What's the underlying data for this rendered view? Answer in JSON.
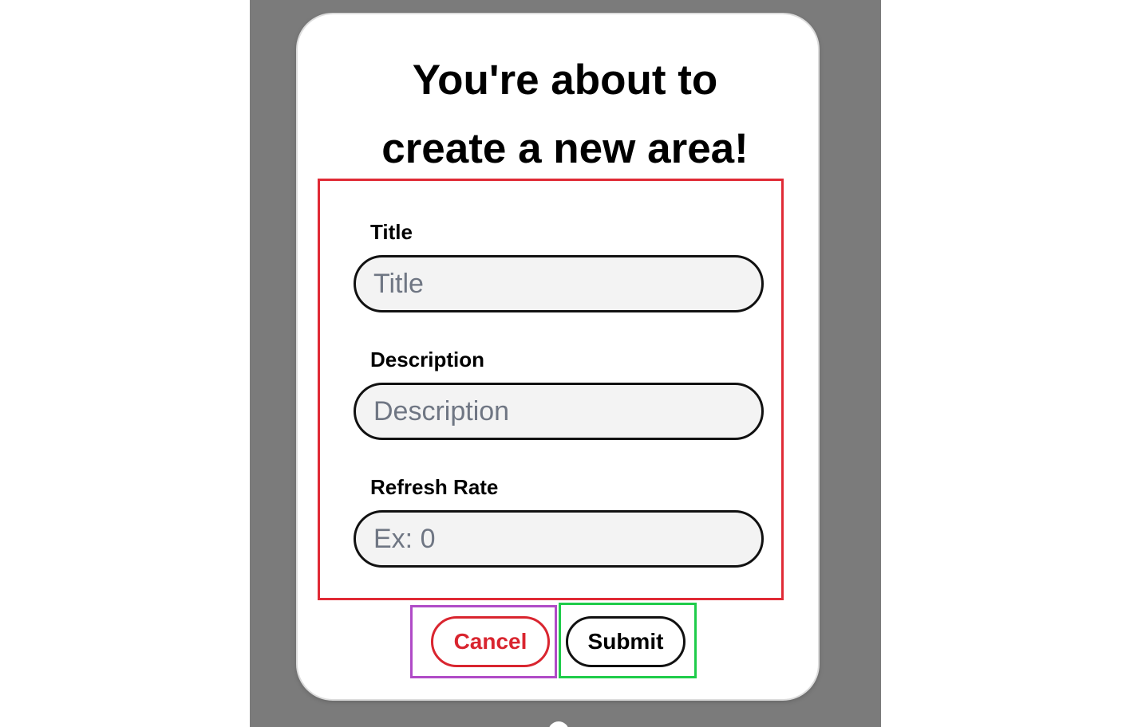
{
  "dialog": {
    "title_line1": "You're about to",
    "title_line2": "create a new area!"
  },
  "form": {
    "fields": [
      {
        "label": "Title",
        "placeholder": "Title",
        "value": ""
      },
      {
        "label": "Description",
        "placeholder": "Description",
        "value": ""
      },
      {
        "label": "Refresh Rate",
        "placeholder": "Ex: 0",
        "value": ""
      }
    ]
  },
  "actions": {
    "cancel_label": "Cancel",
    "submit_label": "Submit"
  },
  "colors": {
    "backdrop": "#7b7b7b",
    "form_frame": "#e02a35",
    "cancel_frame": "#b04bc7",
    "submit_frame": "#1fcc4a",
    "cancel_accent": "#d9252f"
  }
}
